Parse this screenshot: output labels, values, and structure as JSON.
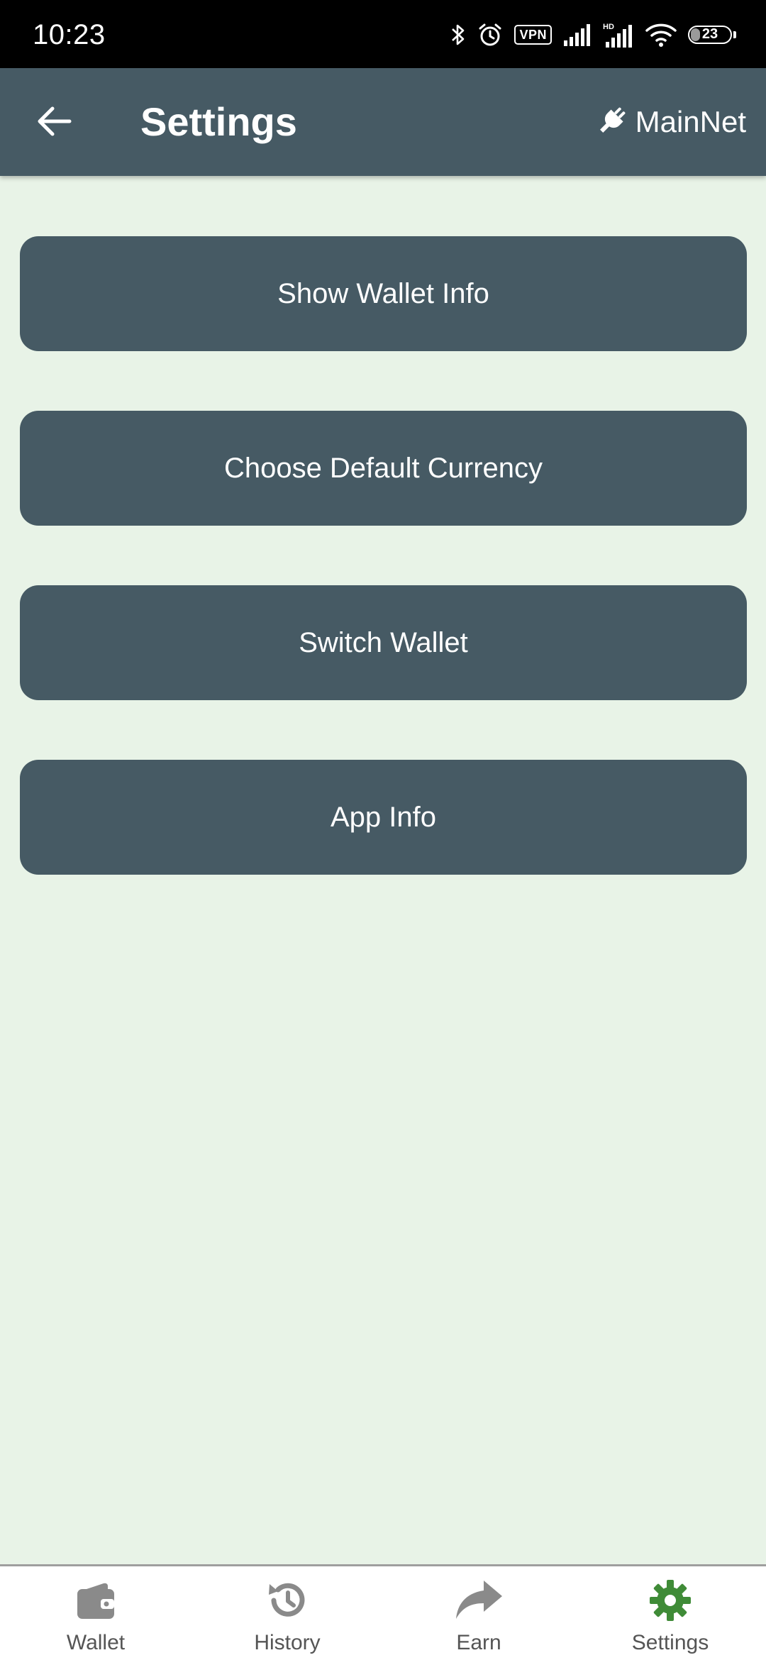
{
  "status_bar": {
    "time": "10:23",
    "vpn_label": "VPN",
    "battery_level": "23",
    "icons": [
      "bluetooth-icon",
      "alarm-icon",
      "vpn-icon",
      "signal-icon",
      "hd-signal-icon",
      "wifi-icon",
      "battery-icon"
    ]
  },
  "app_bar": {
    "title": "Settings",
    "network_label": "MainNet",
    "back_icon": "arrow-left-icon",
    "network_icon": "plug-icon"
  },
  "settings": {
    "items": [
      {
        "label": "Show Wallet Info"
      },
      {
        "label": "Choose Default Currency"
      },
      {
        "label": "Switch Wallet"
      },
      {
        "label": "App Info"
      }
    ]
  },
  "bottom_nav": {
    "items": [
      {
        "label": "Wallet",
        "icon": "wallet-icon",
        "active": false
      },
      {
        "label": "History",
        "icon": "history-icon",
        "active": false
      },
      {
        "label": "Earn",
        "icon": "share-arrow-icon",
        "active": false
      },
      {
        "label": "Settings",
        "icon": "gear-icon",
        "active": true
      }
    ],
    "active_color": "#3f8b37",
    "inactive_color": "#8a8a8a"
  },
  "colors": {
    "app_bar": "#465a64",
    "background": "#e8f3e7",
    "button": "#465a64"
  }
}
